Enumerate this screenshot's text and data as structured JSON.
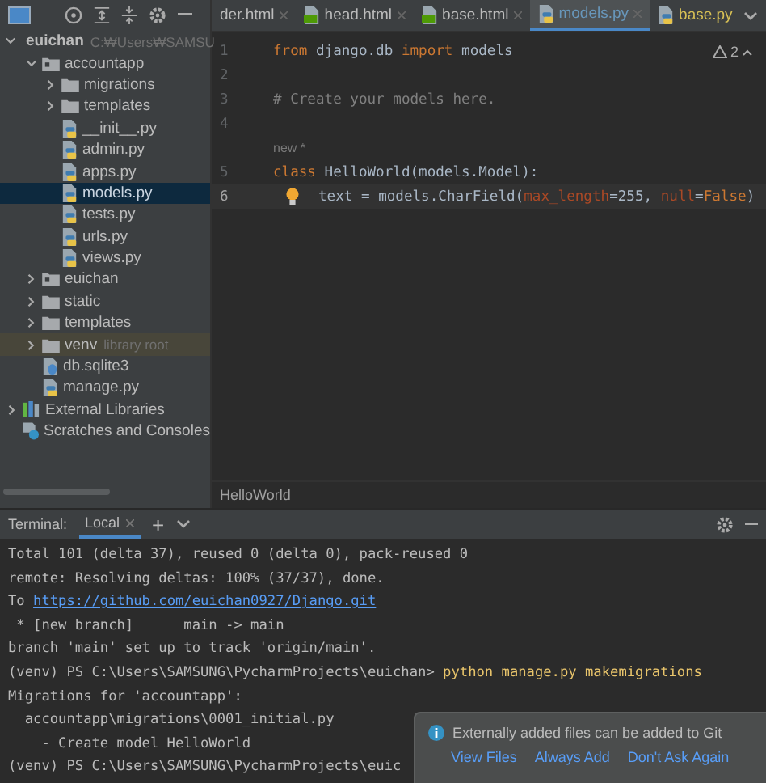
{
  "project_tree": [
    {
      "label": "euichan",
      "hint": "C:₩Users₩SAMSU",
      "kind": "module",
      "expanded": true,
      "selected": false,
      "children": [
        {
          "label": "accountapp",
          "kind": "package",
          "expanded": true,
          "selected": false,
          "children": [
            {
              "label": "migrations",
              "kind": "folder",
              "expanded": false,
              "selected": false
            },
            {
              "label": "templates",
              "kind": "folder",
              "expanded": false,
              "selected": false
            },
            {
              "label": "__init__.py",
              "kind": "python",
              "selected": false
            },
            {
              "label": "admin.py",
              "kind": "python",
              "selected": false
            },
            {
              "label": "apps.py",
              "kind": "python",
              "selected": false
            },
            {
              "label": "models.py",
              "kind": "python",
              "selected": true
            },
            {
              "label": "tests.py",
              "kind": "python",
              "selected": false
            },
            {
              "label": "urls.py",
              "kind": "python",
              "selected": false
            },
            {
              "label": "views.py",
              "kind": "python",
              "selected": false
            }
          ]
        },
        {
          "label": "euichan",
          "kind": "package",
          "expanded": false,
          "selected": false
        },
        {
          "label": "static",
          "kind": "folder",
          "expanded": false,
          "selected": false
        },
        {
          "label": "templates",
          "kind": "folder",
          "expanded": false,
          "selected": false
        },
        {
          "label": "venv",
          "hint": "library root",
          "kind": "folder",
          "expanded": false,
          "selected": false,
          "highlighted": true
        },
        {
          "label": "db.sqlite3",
          "kind": "db",
          "selected": false
        },
        {
          "label": "manage.py",
          "kind": "python",
          "selected": false
        }
      ]
    },
    {
      "label": "External Libraries",
      "kind": "libraries",
      "expanded": false,
      "selected": false
    },
    {
      "label": "Scratches and Consoles",
      "kind": "scratches",
      "selected": false
    }
  ],
  "editor_tabs": [
    {
      "label": "der.html",
      "kind": "partial",
      "selected": false,
      "color": "#bbbbbb"
    },
    {
      "label": "head.html",
      "kind": "html",
      "selected": false,
      "color": "#bbbbbb"
    },
    {
      "label": "base.html",
      "kind": "html",
      "selected": false,
      "color": "#bbbbbb"
    },
    {
      "label": "models.py",
      "kind": "python",
      "selected": true,
      "color": "#6897bb"
    },
    {
      "label": "base.py",
      "kind": "python",
      "selected": false,
      "color": "#d6bf55"
    }
  ],
  "editor": {
    "warnings": "2",
    "lines": [
      {
        "kind": "code",
        "number": "1",
        "current": false,
        "segments": [
          {
            "t": "from",
            "kind": "kw"
          },
          {
            "t": " django.db ",
            "kind": "plain"
          },
          {
            "t": "import",
            "kind": "kw"
          },
          {
            "t": " models",
            "kind": "plain"
          }
        ]
      },
      {
        "kind": "code",
        "number": "2",
        "current": false
      },
      {
        "kind": "code",
        "number": "3",
        "current": false,
        "segments": [
          {
            "t": "# Create your models here.",
            "kind": "comment"
          }
        ]
      },
      {
        "kind": "code",
        "number": "4",
        "current": false
      },
      {
        "kind": "hint",
        "text": "new *"
      },
      {
        "kind": "code",
        "number": "5",
        "current": false,
        "segments": [
          {
            "t": "class",
            "kind": "kw"
          },
          {
            "t": " HelloWorld(models.Model):",
            "kind": "plain"
          }
        ]
      },
      {
        "kind": "code",
        "number": "6",
        "current": true,
        "bulb": true,
        "segments": [
          {
            "t": "text = models.CharField(",
            "kind": "plain"
          },
          {
            "t": "max_length",
            "kind": "param"
          },
          {
            "t": "=255, ",
            "kind": "plain"
          },
          {
            "t": "null",
            "kind": "param"
          },
          {
            "t": "=",
            "kind": "plain"
          },
          {
            "t": "False",
            "kind": "kw"
          },
          {
            "t": ")",
            "kind": "plain"
          }
        ]
      }
    ]
  },
  "breadcrumb": "HelloWorld",
  "terminal": {
    "title": "Terminal:",
    "tabs": [
      {
        "label": "Local",
        "selected": true
      }
    ],
    "add": "+",
    "lines": [
      [
        {
          "t": "Total 101 (delta 37), reused 0 (delta 0), pack-reused 0",
          "kind": "plain"
        }
      ],
      [
        {
          "t": "remote: Resolving deltas: 100% (37/37), done.",
          "kind": "plain"
        }
      ],
      [
        {
          "t": "To ",
          "kind": "plain"
        },
        {
          "t": "https://github.com/euichan0927/Django.git",
          "kind": "link"
        }
      ],
      [
        {
          "t": " * [new branch]      main -> main",
          "kind": "plain"
        }
      ],
      [
        {
          "t": "branch 'main' set up to track 'origin/main'.",
          "kind": "plain"
        }
      ],
      [
        {
          "t": "(venv) PS C:\\Users\\SAMSUNG\\PycharmProjects\\euichan> ",
          "kind": "plain"
        },
        {
          "t": "python manage.py makemigrations",
          "kind": "command"
        }
      ],
      [
        {
          "t": "Migrations for 'accountapp':",
          "kind": "plain"
        }
      ],
      [
        {
          "t": "  accountapp\\migrations\\0001_initial.py",
          "kind": "plain"
        }
      ],
      [
        {
          "t": "    - Create model HelloWorld",
          "kind": "plain"
        }
      ],
      [
        {
          "t": "(venv) PS C:\\Users\\SAMSUNG\\PycharmProjects\\euic",
          "kind": "plain"
        }
      ]
    ]
  },
  "notification": {
    "message": "Externally added files can be added to Git",
    "actions": [
      "View Files",
      "Always Add",
      "Don't Ask Again"
    ]
  }
}
